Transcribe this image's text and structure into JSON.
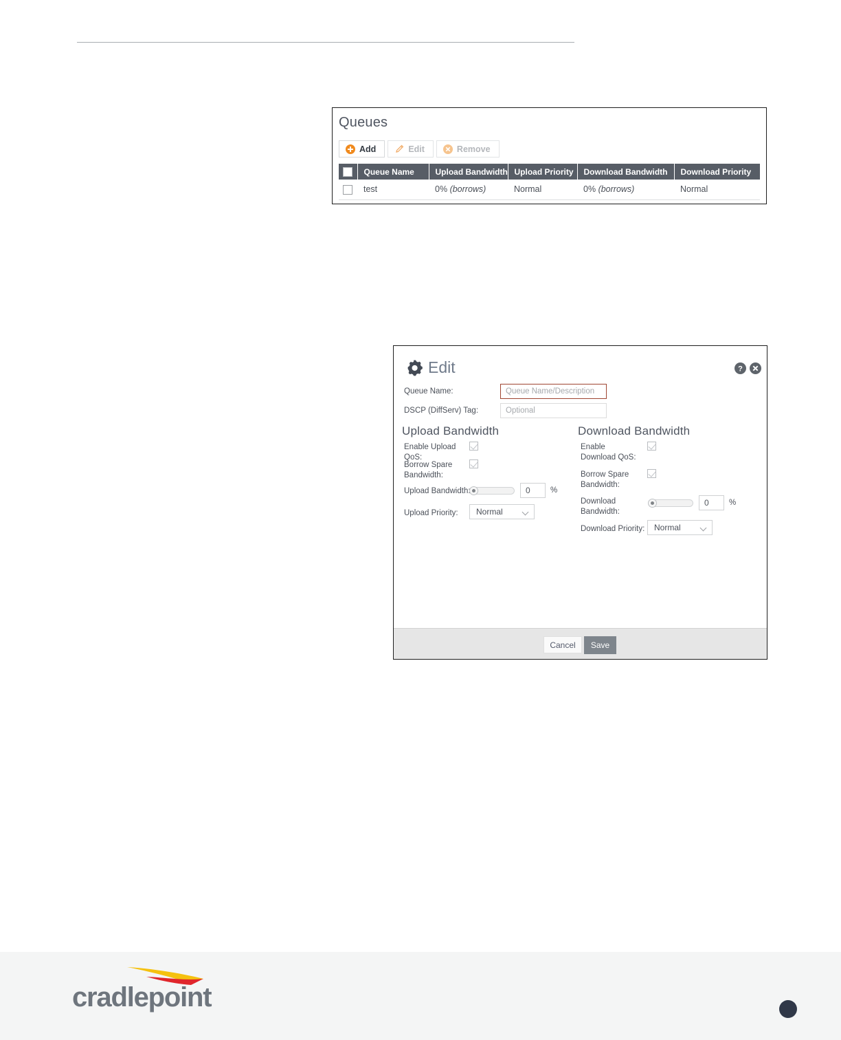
{
  "document": {
    "top_rule": true
  },
  "queues_panel": {
    "title": "Queues",
    "toolbar": [
      {
        "label": "Add",
        "icon": "plus-circle-icon",
        "enabled": true
      },
      {
        "label": "Edit",
        "icon": "pencil-icon",
        "enabled": false
      },
      {
        "label": "Remove",
        "icon": "x-circle-icon",
        "enabled": false
      }
    ],
    "table": {
      "columns": [
        "Queue Name",
        "Upload Bandwidth",
        "Upload Priority",
        "Download Bandwidth",
        "Download Priority"
      ],
      "rows": [
        {
          "queue_name": "test",
          "upload_bandwidth": "0%",
          "upload_bandwidth_note": "(borrows)",
          "upload_priority": "Normal",
          "download_bandwidth": "0%",
          "download_bandwidth_note": "(borrows)",
          "download_priority": "Normal"
        }
      ]
    }
  },
  "edit_dialog": {
    "title": "Edit",
    "gear_icon": "gear-icon",
    "help_icon": "help-icon",
    "close_icon": "close-icon",
    "fields": {
      "queue_name_label": "Queue Name:",
      "queue_name_value": "",
      "queue_name_placeholder": "Queue Name/Description",
      "dscp_label": "DSCP (DiffServ) Tag:",
      "dscp_value": "",
      "dscp_placeholder": "Optional"
    },
    "upload": {
      "section_title": "Upload Bandwidth",
      "enable_label": "Enable Upload QoS:",
      "enable_checked": true,
      "borrow_label": "Borrow Spare Bandwidth:",
      "borrow_checked": true,
      "bandwidth_label": "Upload Bandwidth:",
      "bandwidth_value": "0",
      "bandwidth_unit": "%",
      "slider_position_pct": 0,
      "priority_label": "Upload Priority:",
      "priority_value": "Normal"
    },
    "download": {
      "section_title": "Download Bandwidth",
      "enable_label": "Enable Download QoS:",
      "enable_checked": true,
      "borrow_label": "Borrow Spare Bandwidth:",
      "borrow_checked": true,
      "bandwidth_label": "Download Bandwidth:",
      "bandwidth_value": "0",
      "bandwidth_unit": "%",
      "slider_position_pct": 0,
      "priority_label": "Download Priority:",
      "priority_value": "Normal"
    },
    "footer": {
      "cancel_label": "Cancel",
      "save_label": "Save"
    }
  },
  "page_footer": {
    "logo_text": "cradlepoint",
    "logo_icon": "cradlepoint-swoosh-icon",
    "page_marker": ""
  },
  "colors": {
    "table_header_bg": "#575d66",
    "accent_orange": "#f08a1e",
    "required_border": "#9e4430",
    "save_button_bg": "#7e858c",
    "dialog_title": "#6f7a8a",
    "logo_gray": "#6e757d",
    "swoosh_yellow": "#f5c10f",
    "swoosh_red": "#e0262b",
    "page_dot": "#303848",
    "footer_bg": "#f4f5f5"
  }
}
